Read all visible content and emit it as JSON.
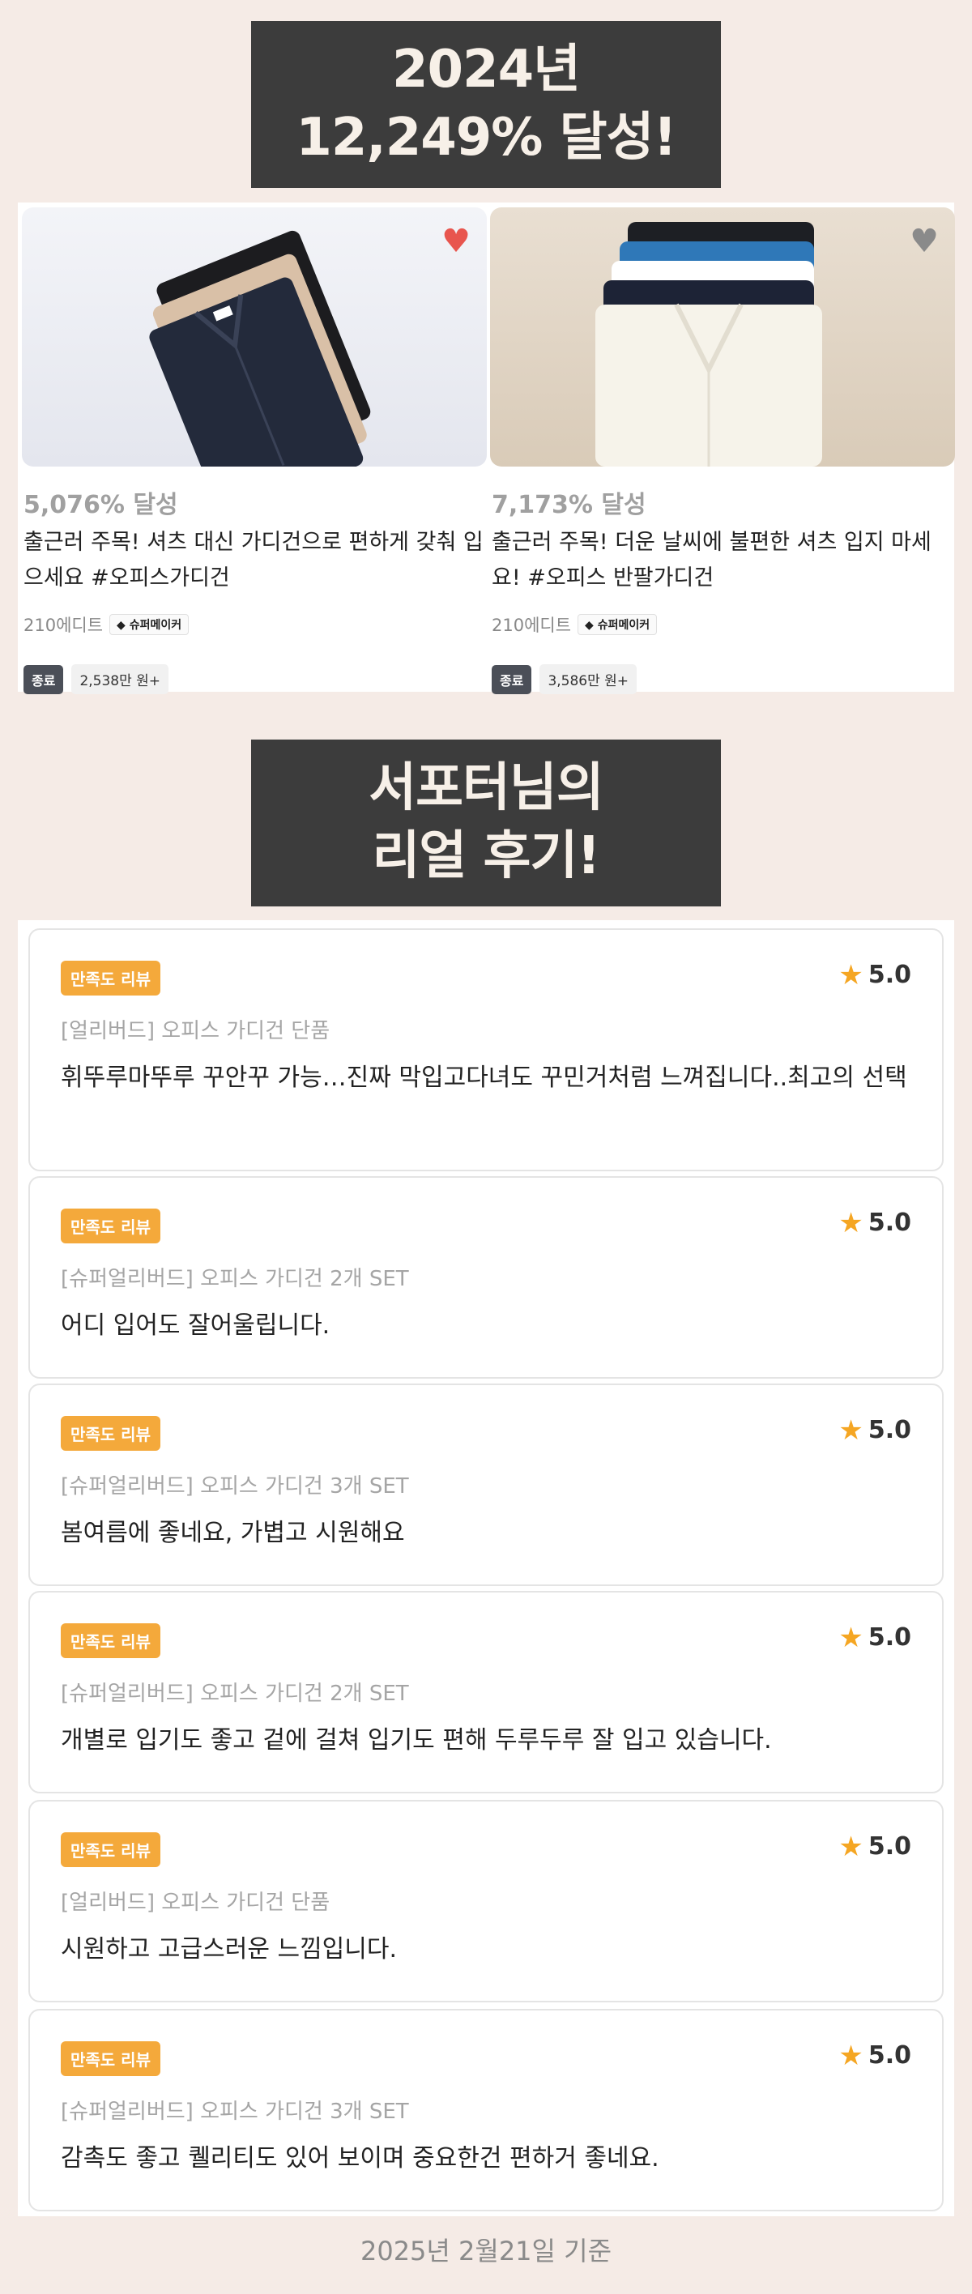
{
  "banner_top": {
    "line1": "2024년",
    "line2": "12,249% 달성!"
  },
  "products": [
    {
      "percent": "5,076% 달성",
      "title": "출근러 주목! 셔츠 대신 가디건으로 편하게 갖춰 입으세요 #오피스가디건",
      "maker": "210에디트",
      "maker_badge": "슈퍼메이커",
      "status": "종료",
      "amount": "2,538만 원+",
      "heart_icon": "heart-filled-icon",
      "heart_color": "#e8554e"
    },
    {
      "percent": "7,173% 달성",
      "title": "출근러 주목! 더운 날씨에 불편한 셔츠 입지 마세요! #오피스 반팔가디건",
      "maker": "210에디트",
      "maker_badge": "슈퍼메이커",
      "status": "종료",
      "amount": "3,586만 원+",
      "heart_icon": "heart-outline-icon",
      "heart_color": "#8a8a8a"
    }
  ],
  "banner_reviews": {
    "line1": "서포터님의",
    "line2": "리얼 후기!"
  },
  "reviews": [
    {
      "tag": "만족도 리뷰",
      "rating": "5.0",
      "product": "[얼리버드] 오피스 가디건 단품",
      "text": "휘뚜루마뚜루 꾸안꾸 가능…진짜 막입고다녀도 꾸민거처럼 느껴집니다..최고의 선택"
    },
    {
      "tag": "만족도 리뷰",
      "rating": "5.0",
      "product": "[슈퍼얼리버드] 오피스 가디건 2개 SET",
      "text": "어디 입어도 잘어울립니다."
    },
    {
      "tag": "만족도 리뷰",
      "rating": "5.0",
      "product": "[슈퍼얼리버드] 오피스 가디건 3개 SET",
      "text": "봄여름에 좋네요, 가볍고 시원해요"
    },
    {
      "tag": "만족도 리뷰",
      "rating": "5.0",
      "product": "[슈퍼얼리버드] 오피스 가디건 2개 SET",
      "text": "개별로 입기도 좋고 겉에 걸쳐 입기도 편해 두루두루 잘 입고 있습니다."
    },
    {
      "tag": "만족도 리뷰",
      "rating": "5.0",
      "product": "[얼리버드] 오피스 가디건 단품",
      "text": "시원하고 고급스러운 느낌입니다."
    },
    {
      "tag": "만족도 리뷰",
      "rating": "5.0",
      "product": "[슈퍼얼리버드] 오피스 가디건 3개 SET",
      "text": "감촉도 좋고 퀠리티도 있어 보이며 중요한건 편하거 좋네요."
    }
  ],
  "footer": "2025년 2월21일 기준",
  "colors": {
    "page_bg": "#f5ebe6",
    "banner_bg": "#3c3c3c",
    "tag_orange": "#f4a93b",
    "star": "#f5a623"
  }
}
